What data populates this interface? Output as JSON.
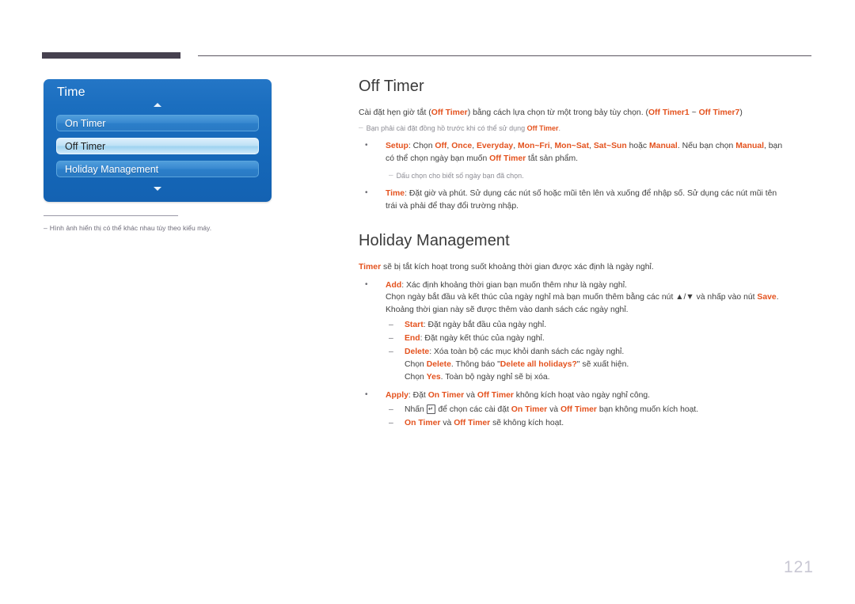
{
  "header": {
    "tab_bar": "",
    "rule": ""
  },
  "osd": {
    "title": "Time",
    "scroll_up_icon": "triangle-up-icon",
    "scroll_down_icon": "triangle-down-icon",
    "items": [
      {
        "label": "On Timer",
        "selected": false
      },
      {
        "label": "Off Timer",
        "selected": true
      },
      {
        "label": "Holiday Management",
        "selected": false
      }
    ],
    "note": {
      "dash": "–",
      "text": "Hình ảnh hiển thị có thể khác nhau tùy theo kiểu máy."
    }
  },
  "content": {
    "off_timer": {
      "title": "Off Timer",
      "lead": {
        "part1": "Cài đặt hẹn giờ tắt (",
        "kw1": "Off Timer",
        "part2": ") bằng cách lựa chọn từ một trong bảy tùy chọn. (",
        "kw2": "Off Timer1",
        "part3": " ~ ",
        "kw3": "Off Timer7",
        "part4": ")"
      },
      "note1": {
        "dash": "–",
        "part1": "Bạn phải cài đặt đồng hồ trước khi có thể sử dụng ",
        "kw1": "Off Timer",
        "part2": "."
      },
      "setup": {
        "kw": "Setup",
        "p1": ": Chọn ",
        "k_off": "Off",
        "c1": ", ",
        "k_once": "Once",
        "c2": ", ",
        "k_everyday": "Everyday",
        "c3": ", ",
        "k_monfri": "Mon~Fri",
        "c4": ", ",
        "k_monsat": "Mon~Sat",
        "c5": ", ",
        "k_satsun": "Sat~Sun",
        "p2": " hoặc ",
        "k_manual": "Manual",
        "p3": ". Nếu bạn chọn ",
        "k_manual2": "Manual",
        "p4": ", bạn",
        "line2a": "có thể chọn ngày bạn muốn ",
        "k_offtimer": "Off Timer",
        "line2b": " tắt sản phẩm."
      },
      "note2": {
        "dash": "–",
        "text": "Dấu chọn cho biết số ngày bạn đã chọn."
      },
      "time": {
        "kw": "Time",
        "line1": ": Đặt giờ và phút. Sử dụng các nút số hoặc mũi tên lên và xuống để nhập số. Sử dụng các nút mũi tên",
        "line2": "trái và phải để thay đổi trường nhập."
      }
    },
    "holiday": {
      "title": "Holiday Management",
      "lead": {
        "kw": "Timer",
        "text": " sẽ bị tắt kích hoạt trong suốt khoảng thời gian được xác định là ngày nghỉ."
      },
      "add": {
        "kw": "Add",
        "line1": ": Xác định khoảng thời gian bạn muốn thêm như là ngày nghỉ.",
        "line2a": "Chọn ngày bắt đầu và kết thúc của ngày nghỉ mà bạn muốn thêm bằng các nút ▲/▼ và nhấp vào nút ",
        "k_save": "Save",
        "line2b": ".",
        "line3": "Khoảng thời gian này sẽ được thêm vào danh sách các ngày nghỉ.",
        "sub": {
          "start": {
            "kw": "Start",
            "text": ": Đặt ngày bắt đầu của ngày nghỉ."
          },
          "end": {
            "kw": "End",
            "text": ": Đặt ngày kết thúc của ngày nghỉ."
          },
          "delete": {
            "kw": "Delete",
            "text": ": Xóa toàn bộ các mục khỏi danh sách các ngày nghỉ.",
            "line2a": "Chọn ",
            "k_delete": "Delete",
            "line2b": ". Thông báo \"",
            "k_dialog": "Delete all holidays?",
            "line2c": "\" sẽ xuất hiện.",
            "line3a": "Chọn ",
            "k_yes": "Yes",
            "line3b": ". Toàn bộ ngày nghỉ sẽ bị xóa."
          }
        }
      },
      "apply": {
        "kw": "Apply",
        "p1": ": Đặt ",
        "k_on": "On Timer",
        "p2": " và ",
        "k_off": "Off Timer",
        "p3": " không kích hoạt vào ngày nghỉ công.",
        "sub1": {
          "p1": "Nhấn ",
          "icon": "enter-key-icon",
          "icon_glyph": "↵",
          "p2": " để chọn các cài đặt ",
          "k_on": "On Timer",
          "p3": " và ",
          "k_off": "Off Timer",
          "p4": " bạn không muốn kích hoạt."
        },
        "sub2": {
          "k_on": "On Timer",
          "p1": " và ",
          "k_off": "Off Timer",
          "p2": " sẽ không kích hoạt."
        }
      }
    }
  },
  "footer": {
    "page_number": "121"
  },
  "colors": {
    "keyword": "#e4531f",
    "osd_blue": "#1b6ebf",
    "osd_selected": "#bfe2f6",
    "header_bar": "#46414f",
    "page_number": "#c9c8d4"
  }
}
